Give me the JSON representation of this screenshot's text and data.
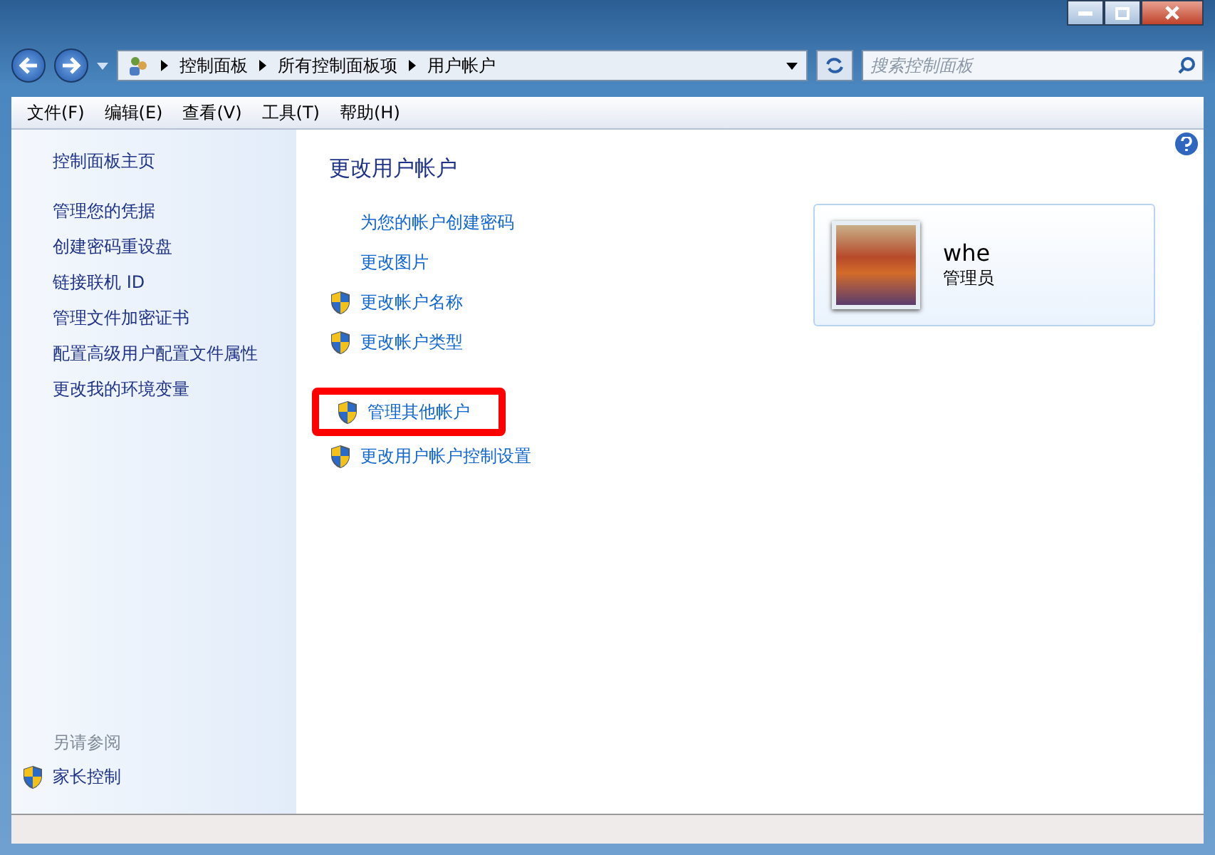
{
  "address_bar": {
    "crumbs": [
      "控制面板",
      "所有控制面板项",
      "用户帐户"
    ]
  },
  "search": {
    "placeholder": "搜索控制面板"
  },
  "menu": [
    "文件(F)",
    "编辑(E)",
    "查看(V)",
    "工具(T)",
    "帮助(H)"
  ],
  "sidebar": {
    "items": [
      {
        "label": "控制面板主页",
        "kind": "home"
      },
      {
        "label": "管理您的凭据",
        "kind": "link"
      },
      {
        "label": "创建密码重设盘",
        "kind": "link"
      },
      {
        "label": "链接联机 ID",
        "kind": "link"
      },
      {
        "label": "管理文件加密证书",
        "kind": "link"
      },
      {
        "label": "配置高级用户配置文件属性",
        "kind": "link"
      },
      {
        "label": "更改我的环境变量",
        "kind": "link"
      }
    ],
    "see_also_title": "另请参阅",
    "see_also": [
      {
        "label": "家长控制",
        "kind": "shield"
      }
    ]
  },
  "heading": "更改用户帐户",
  "tasks": [
    {
      "label": "为您的帐户创建密码",
      "kind": "plain",
      "highlighted": false
    },
    {
      "label": "更改图片",
      "kind": "plain",
      "highlighted": false
    },
    {
      "label": "更改帐户名称",
      "kind": "shield",
      "highlighted": false
    },
    {
      "label": "更改帐户类型",
      "kind": "shield",
      "highlighted": false
    },
    {
      "label": "管理其他帐户",
      "kind": "shield",
      "highlighted": true,
      "group_break": true
    },
    {
      "label": "更改用户帐户控制设置",
      "kind": "shield",
      "highlighted": false
    }
  ],
  "account": {
    "name": "whe",
    "role": "管理员"
  }
}
